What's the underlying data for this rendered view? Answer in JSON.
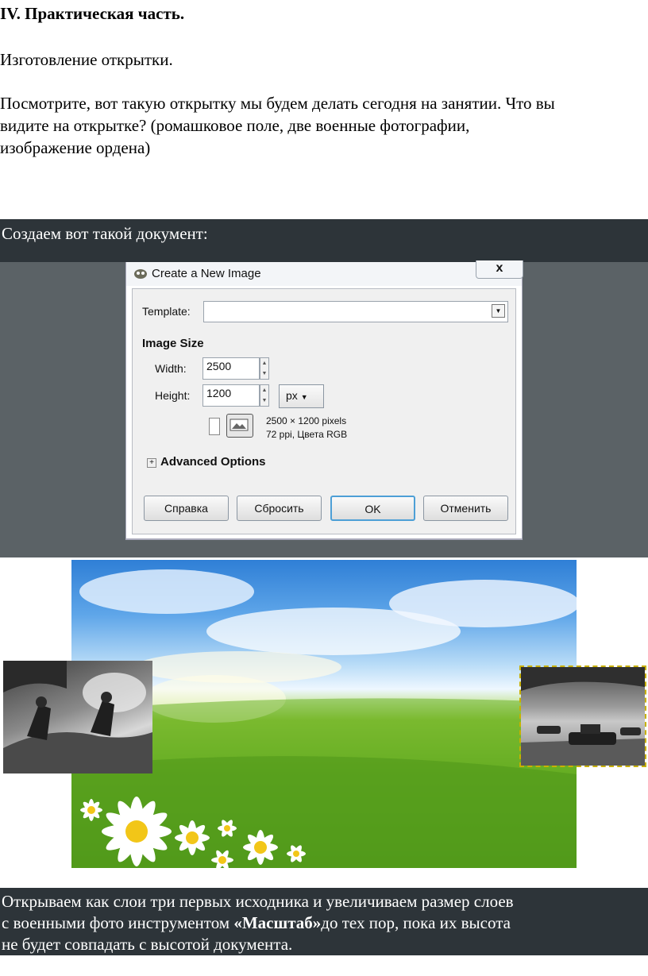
{
  "heading": "IV. Практическая часть.",
  "subheading": "Изготовление открытки.",
  "intro_lines": [
    "Посмотрите, вот такую открытку мы будем делать сегодня на занятии. Что вы",
    "видите на открытке? (ромашковое поле, две военные фотографии,",
    "изображение ордена)"
  ],
  "band1_text": "Создаем вот такой документ:",
  "dialog": {
    "title": "Create a New Image",
    "close_glyph": "x",
    "template_label": "Template:",
    "template_value": "",
    "image_size_label": "Image Size",
    "width_label": "Width:",
    "width_value": "2500",
    "height_label": "Height:",
    "height_value": "1200",
    "unit": "px",
    "info_line1": "2500 × 1200 pixels",
    "info_line2": "72 ppi, Цвета RGB",
    "advanced_label": "Advanced Options",
    "buttons": {
      "help": "Справка",
      "reset": "Сбросить",
      "ok": "OK",
      "cancel": "Отменить"
    }
  },
  "band2_lines": [
    "Открываем как слои три первых исходника и увеличиваем размер слоев",
    [
      "с военными фото инструментом ",
      "«Масштаб»",
      "до тех пор, пока их высота"
    ],
    "не будет совпадать с высотой документа."
  ],
  "colors": {
    "band": "#2d3439",
    "sky": "#4a96e0",
    "grass": "#5ea61f"
  }
}
